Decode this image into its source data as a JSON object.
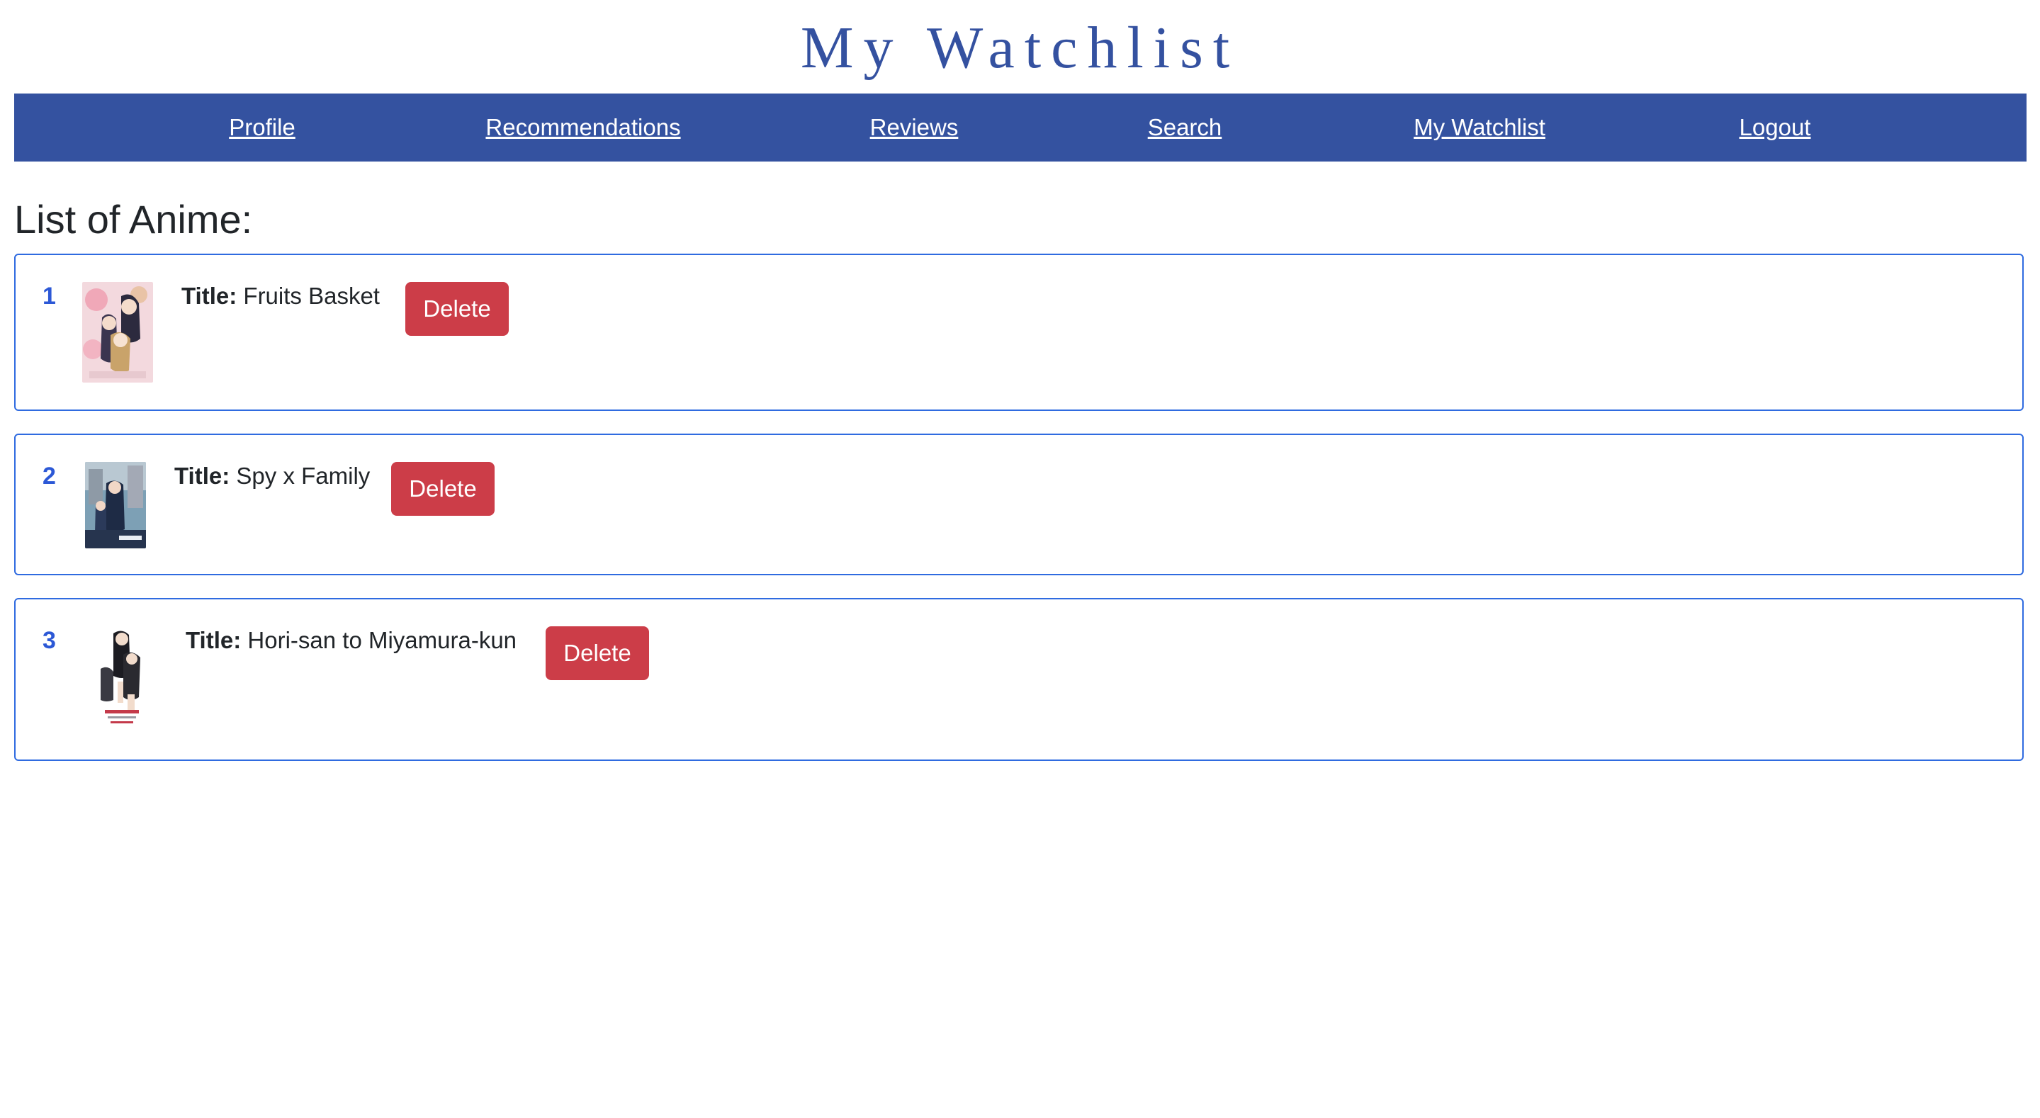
{
  "header": {
    "title": "My Watchlist"
  },
  "nav": {
    "items": [
      {
        "label": "Profile"
      },
      {
        "label": "Recommendations"
      },
      {
        "label": "Reviews"
      },
      {
        "label": "Search"
      },
      {
        "label": "My Watchlist"
      },
      {
        "label": "Logout"
      }
    ]
  },
  "main": {
    "heading": "List of Anime:",
    "title_label": "Title:",
    "delete_label": "Delete",
    "items": [
      {
        "index": "1",
        "title": "Fruits Basket",
        "poster_icon": "fruits-basket-poster"
      },
      {
        "index": "2",
        "title": "Spy x Family",
        "poster_icon": "spy-x-family-poster"
      },
      {
        "index": "3",
        "title": "Hori-san to Miyamura-kun",
        "poster_icon": "hori-san-to-miyamura-kun-poster"
      }
    ]
  },
  "colors": {
    "brand": "#3452a0",
    "card_border": "#2f6be0",
    "index_text": "#2c58d6",
    "delete_button": "#cc3d48"
  }
}
